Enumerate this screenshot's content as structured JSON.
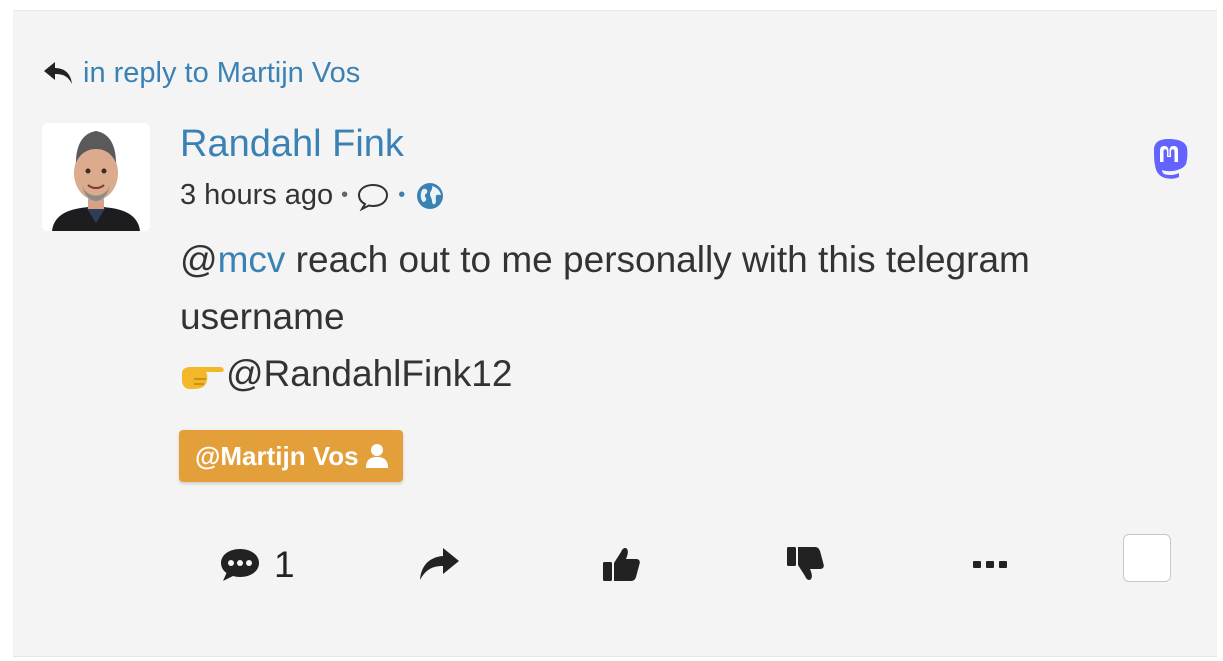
{
  "reply": {
    "label": "in reply to Martijn Vos"
  },
  "author": {
    "name": "Randahl Fink"
  },
  "meta": {
    "time": "3 hours ago",
    "sep1": "•",
    "sep2": "•"
  },
  "content": {
    "prefix": "@",
    "mention": "mcv",
    "text": " reach out to me personally with this telegram username",
    "line2": "@RandahlFink12"
  },
  "tag": {
    "label": "@Martijn Vos"
  },
  "actions": {
    "comment_count": "1"
  },
  "colors": {
    "link": "#3b82b4",
    "tag": "#e3a03a",
    "mastodon": "#6364ff"
  },
  "icons": [
    "reply-icon",
    "comment-icon",
    "globe-icon",
    "mastodon-icon",
    "user-icon",
    "comments-icon",
    "share-icon",
    "thumbs-up-icon",
    "thumbs-down-icon",
    "more-icon"
  ]
}
